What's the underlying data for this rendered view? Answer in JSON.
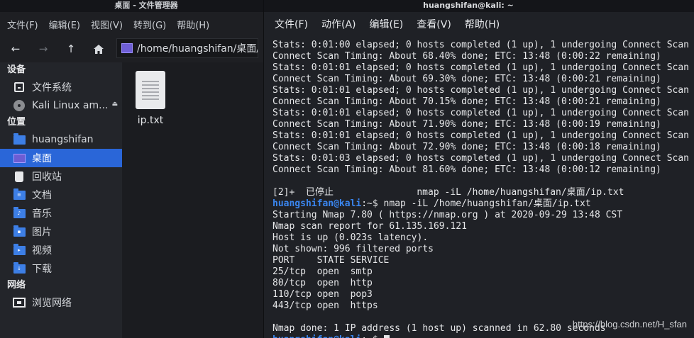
{
  "file_manager": {
    "title": "桌面 - 文件管理器",
    "menu": [
      "文件(F)",
      "编辑(E)",
      "视图(V)",
      "转到(G)",
      "帮助(H)"
    ],
    "path": "/home/huangshifan/桌面/",
    "sidebar": {
      "devices_header": "设备",
      "devices": [
        {
          "label": "文件系统",
          "icon": "drive-icon"
        },
        {
          "label": "Kali Linux am...",
          "icon": "disc-icon"
        }
      ],
      "places_header": "位置",
      "places": [
        {
          "label": "huangshifan",
          "icon": "home-folder-icon"
        },
        {
          "label": "桌面",
          "icon": "desktop-icon"
        },
        {
          "label": "回收站",
          "icon": "trash-icon"
        },
        {
          "label": "文档",
          "icon": "documents-folder-icon"
        },
        {
          "label": "音乐",
          "icon": "music-folder-icon"
        },
        {
          "label": "图片",
          "icon": "pictures-folder-icon"
        },
        {
          "label": "视频",
          "icon": "videos-folder-icon"
        },
        {
          "label": "下载",
          "icon": "downloads-folder-icon"
        }
      ],
      "network_header": "网络",
      "network": [
        {
          "label": "浏览网络",
          "icon": "network-icon"
        }
      ]
    },
    "files": [
      {
        "name": "ip.txt"
      }
    ]
  },
  "terminal": {
    "title": "huangshifan@kali: ~",
    "menu": [
      "文件(F)",
      "动作(A)",
      "编辑(E)",
      "查看(V)",
      "帮助(H)"
    ],
    "lines": [
      "Stats: 0:01:00 elapsed; 0 hosts completed (1 up), 1 undergoing Connect Scan",
      "Connect Scan Timing: About 68.40% done; ETC: 13:48 (0:00:22 remaining)",
      "Stats: 0:01:01 elapsed; 0 hosts completed (1 up), 1 undergoing Connect Scan",
      "Connect Scan Timing: About 69.30% done; ETC: 13:48 (0:00:21 remaining)",
      "Stats: 0:01:01 elapsed; 0 hosts completed (1 up), 1 undergoing Connect Scan",
      "Connect Scan Timing: About 70.15% done; ETC: 13:48 (0:00:21 remaining)",
      "Stats: 0:01:01 elapsed; 0 hosts completed (1 up), 1 undergoing Connect Scan",
      "Connect Scan Timing: About 71.90% done; ETC: 13:48 (0:00:19 remaining)",
      "Stats: 0:01:01 elapsed; 0 hosts completed (1 up), 1 undergoing Connect Scan",
      "Connect Scan Timing: About 72.90% done; ETC: 13:48 (0:00:18 remaining)",
      "Stats: 0:01:03 elapsed; 0 hosts completed (1 up), 1 undergoing Connect Scan",
      "Connect Scan Timing: About 81.60% done; ETC: 13:48 (0:00:12 remaining)",
      "",
      "[2]+  已停止               nmap -iL /home/huangshifan/桌面/ip.txt"
    ],
    "prompt_user": "huangshifan@kali",
    "prompt_path": ":~$",
    "command": " nmap -iL /home/huangshifan/桌面/ip.txt",
    "output": [
      "Starting Nmap 7.80 ( https://nmap.org ) at 2020-09-29 13:48 CST",
      "Nmap scan report for 61.135.169.121",
      "Host is up (0.023s latency).",
      "Not shown: 996 filtered ports",
      "PORT    STATE SERVICE",
      "25/tcp  open  smtp",
      "80/tcp  open  http",
      "110/tcp open  pop3",
      "443/tcp open  https",
      "",
      "Nmap done: 1 IP address (1 host up) scanned in 62.80 seconds"
    ]
  },
  "watermark": "https://blog.csdn.net/H_sfan"
}
